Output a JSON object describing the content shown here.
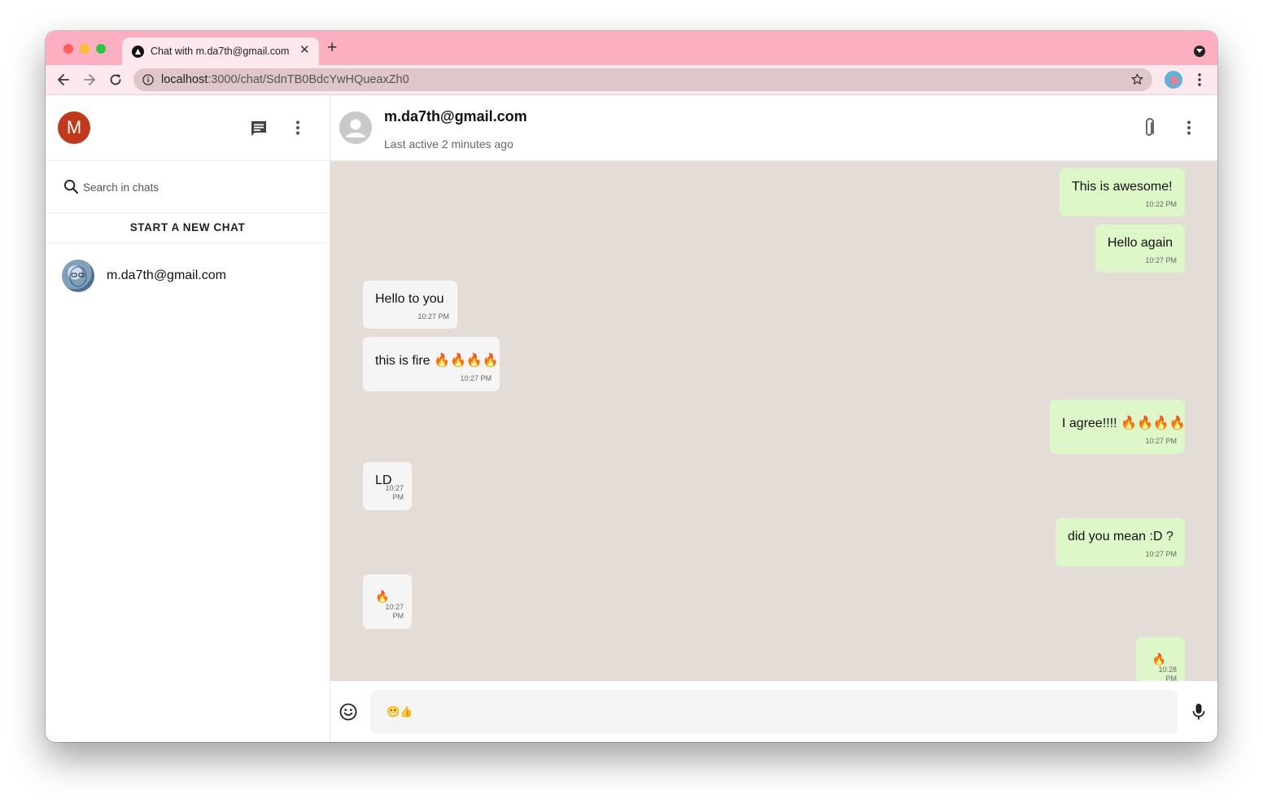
{
  "browser": {
    "tab_title": "Chat with m.da7th@gmail.com",
    "tab_close": "✕",
    "new_tab": "+",
    "url_host": "localhost",
    "url_path": ":3000/chat/SdnTB0BdcYwHQueaxZh0",
    "tabbar_color": "#fbafc0",
    "toolbar_color": "#fce8ed"
  },
  "sidebar": {
    "user_initial": "M",
    "user_avatar_color": "#c0391b",
    "search_placeholder": "Search in chats",
    "new_chat_label": "START A NEW CHAT",
    "chats": [
      {
        "name": "m.da7th@gmail.com"
      }
    ]
  },
  "conversation": {
    "contact_name": "m.da7th@gmail.com",
    "last_active": "Last active 2 minutes ago",
    "background_color": "#e4ddd7",
    "sent_bubble_color": "#ddf7c8",
    "received_bubble_color": "#f5f5f5",
    "messages": [
      {
        "direction": "sent",
        "text": "This is awesome!",
        "time": "10:22 PM"
      },
      {
        "direction": "sent",
        "text": "Hello again",
        "time": "10:27 PM"
      },
      {
        "direction": "received",
        "text": "Hello to you",
        "time": "10:27 PM"
      },
      {
        "direction": "received",
        "text": "this is fire 🔥🔥🔥🔥",
        "time": "10:27 PM"
      },
      {
        "direction": "sent",
        "text": "I agree!!!! 🔥🔥🔥🔥",
        "time": "10:27 PM"
      },
      {
        "direction": "received",
        "text": "LD",
        "time": "10:27 PM"
      },
      {
        "direction": "sent",
        "text": "did you mean :D ?",
        "time": "10:27 PM"
      },
      {
        "direction": "received",
        "text": "🔥",
        "time": "10:27 PM"
      },
      {
        "direction": "sent",
        "text": "🔥",
        "time": "10:28 PM"
      }
    ],
    "composer_value": "😬👍"
  },
  "icons": {
    "sidebar_new_chat": "chat-icon",
    "sidebar_menu": "more-vert-icon",
    "search": "search-icon",
    "attach": "paperclip-icon",
    "chat_menu": "more-vert-icon",
    "emoji": "emoji-icon",
    "mic": "mic-icon"
  }
}
